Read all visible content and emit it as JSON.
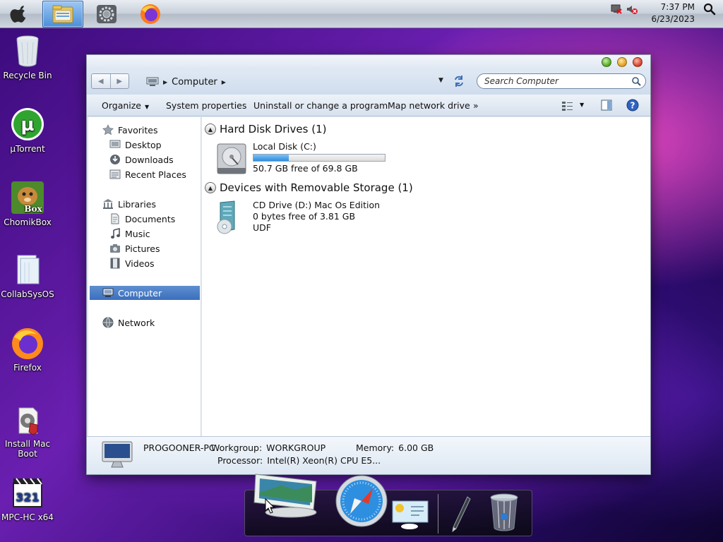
{
  "topbar": {
    "taskbar_items": [
      {
        "name": "file-explorer-icon"
      },
      {
        "name": "settings-gear-icon"
      },
      {
        "name": "firefox-icon"
      }
    ],
    "time": "7:37 PM",
    "date": "6/23/2023"
  },
  "desktop": {
    "icons": [
      {
        "label": "Recycle Bin",
        "icon": "recycle-bin-icon"
      },
      {
        "label": "µTorrent",
        "icon": "utorrent-icon"
      },
      {
        "label": "ChomikBox",
        "icon": "chomikbox-icon"
      },
      {
        "label": "CollabSysOS",
        "icon": "folder-icon"
      },
      {
        "label": "Firefox",
        "icon": "firefox-icon"
      },
      {
        "label": "Install Mac Boot",
        "icon": "installer-icon"
      },
      {
        "label": "MPC-HC x64",
        "icon": "mpc-hc-icon"
      }
    ]
  },
  "window": {
    "breadcrumb": [
      "Computer"
    ],
    "search_placeholder": "Search Computer",
    "toolbar": {
      "organize": "Organize",
      "system_properties": "System properties",
      "uninstall": "Uninstall or change a program",
      "map_drive": "Map network drive",
      "more": "»"
    },
    "nav": {
      "favorites": "Favorites",
      "desktop": "Desktop",
      "downloads": "Downloads",
      "recent": "Recent Places",
      "libraries": "Libraries",
      "documents": "Documents",
      "music": "Music",
      "pictures": "Pictures",
      "videos": "Videos",
      "computer": "Computer",
      "network": "Network"
    },
    "groups": {
      "hdd_title": "Hard Disk Drives (1)",
      "removable_title": "Devices with Removable Storage (1)"
    },
    "drives": {
      "c": {
        "name": "Local Disk (C:)",
        "free": "50.7 GB free of 69.8 GB",
        "used_fraction": 0.27
      },
      "d": {
        "name": "CD Drive (D:) Mac Os Edition",
        "free": "0 bytes free of 3.81 GB",
        "fs": "UDF"
      }
    },
    "details": {
      "pc_name": "PROGOONER-PC",
      "workgroup_label": "Workgroup:",
      "workgroup": "WORKGROUP",
      "memory_label": "Memory:",
      "memory": "6.00 GB",
      "processor_label": "Processor:",
      "processor": "Intel(R) Xeon(R) CPU E5..."
    }
  },
  "dock": {
    "items": [
      "display-icon",
      "safari-compass-icon",
      "weather-widget-icon",
      "pen-icon",
      "trash-icon"
    ]
  },
  "colors": {
    "selection": "#3b6fbd",
    "progress": "#2d8de0"
  }
}
